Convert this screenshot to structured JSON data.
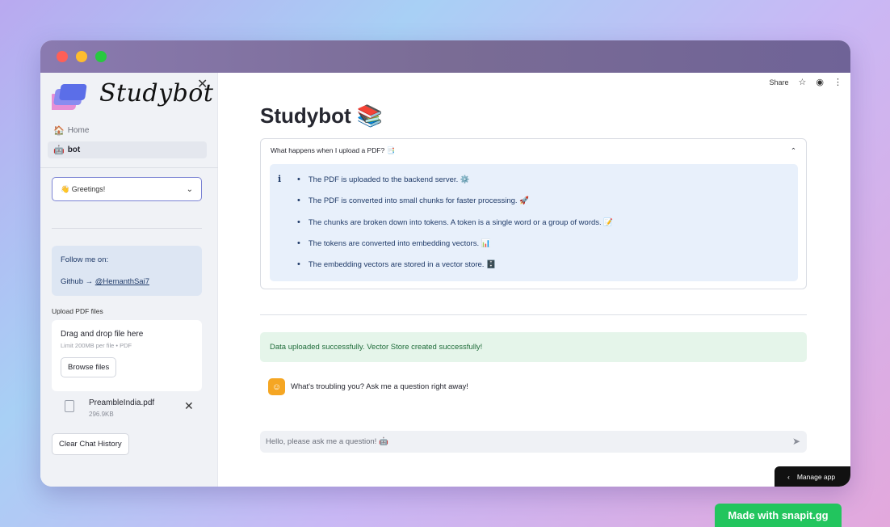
{
  "window": {
    "traffic_lights": [
      "close",
      "minimize",
      "maximize"
    ]
  },
  "sidebar": {
    "brand": "Studybot",
    "nav": [
      {
        "icon": "house-icon",
        "label": "Home"
      },
      {
        "icon": "robot-icon",
        "label": "bot"
      }
    ],
    "select_value": "👋 Greetings!",
    "follow": {
      "title": "Follow me on:",
      "github_prefix": "Github → ",
      "github_handle": "@HemanthSai7"
    },
    "upload": {
      "label": "Upload PDF files",
      "drop_title": "Drag and drop file here",
      "drop_sub": "Limit 200MB per file • PDF",
      "browse_label": "Browse files"
    },
    "file": {
      "name": "PreambleIndia.pdf",
      "size": "296.9KB"
    },
    "clear_label": "Clear Chat History"
  },
  "main": {
    "toolbar": {
      "share_label": "Share"
    },
    "title": "Studybot 📚",
    "expander": {
      "label": "What happens when I upload a PDF? 📑",
      "items": [
        "The PDF is uploaded to the backend server. ⚙️",
        "The PDF is converted into small chunks for faster processing. 🚀",
        "The chunks are broken down into tokens. A token is a single word or a group of words. 📝",
        "The tokens are converted into embedding vectors. 📊",
        "The embedding vectors are stored in a vector store. 🗄️"
      ]
    },
    "success_message": "Data uploaded successfully. Vector Store created successfully!",
    "assistant_message": "What's troubling you? Ask me a question right away!",
    "chat_placeholder": "Hello, please ask me a question! 🤖",
    "manage_app_label": "Manage app"
  },
  "footer_badge": "Made with snapit.gg",
  "colors": {
    "accent": "#7b83d4",
    "success_bg": "#e5f5ea",
    "info_bg": "#e8f0fb",
    "avatar": "#f5a623",
    "badge": "#22c55e"
  }
}
